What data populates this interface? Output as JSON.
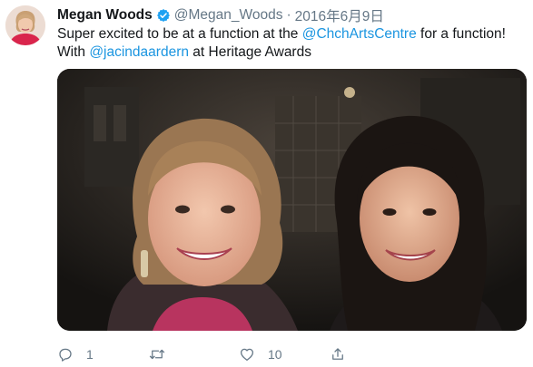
{
  "tweet": {
    "author": {
      "name": "Megan Woods",
      "handle": "@Megan_Woods",
      "verified": true
    },
    "separator": "·",
    "date": "2016年6月9日",
    "text": {
      "part1": "Super excited to be at a function at the ",
      "mention1": "@ChchArtsCentre",
      "part2": " for a function! With ",
      "mention2": "@jacindaardern",
      "part3": " at Heritage Awards"
    },
    "actions": {
      "reply_count": "1",
      "retweet_count": "",
      "like_count": "10",
      "share_count": ""
    }
  },
  "colors": {
    "link": "#1b95e0",
    "secondary_text": "#657786",
    "verified_badge": "#1da1f2"
  },
  "icons": [
    "reply-icon",
    "retweet-icon",
    "like-icon",
    "share-icon",
    "verified-badge-icon"
  ]
}
